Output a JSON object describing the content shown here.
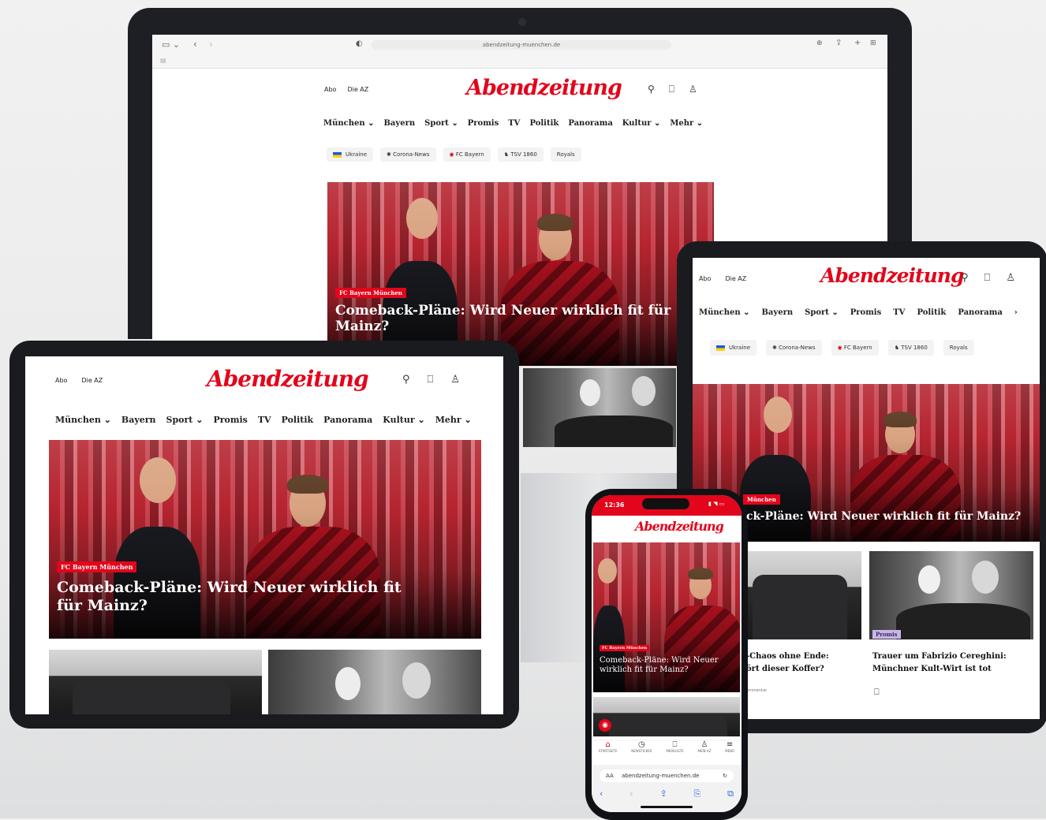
{
  "brand": {
    "logo": "Abendzeitung",
    "accent": "#e3051b"
  },
  "browser": {
    "url": "abendzeitung-muenchen.de"
  },
  "header": {
    "links": [
      "Abo",
      "Die AZ"
    ]
  },
  "nav": [
    "München ⌄",
    "Bayern",
    "Sport ⌄",
    "Promis",
    "TV",
    "Politik",
    "Panorama",
    "Kultur ⌄",
    "Mehr ⌄"
  ],
  "nav_tablet_right": [
    "München ⌄",
    "Bayern",
    "Sport ⌄",
    "Promis",
    "TV",
    "Politik",
    "Panorama",
    "›"
  ],
  "chips": [
    {
      "label": "Ukraine",
      "icon": "ukraine-flag-icon"
    },
    {
      "label": "Corona-News",
      "icon": "virus-icon"
    },
    {
      "label": "FC Bayern",
      "icon": "fc-bayern-icon"
    },
    {
      "label": "TSV 1860",
      "icon": "tsv-1860-icon"
    },
    {
      "label": "Royals",
      "icon": ""
    }
  ],
  "hero": {
    "badge": "FC Bayern München",
    "headline": "Comeback-Pläne: Wird Neuer wirklich fit für Mainz?",
    "headline_cropped": "ck-Pläne: Wird Neuer wirklich fit für Mainz?",
    "badge_cropped": "München"
  },
  "articles": [
    {
      "title_cropped": "-Chaos ohne Ende:",
      "title_cropped_2": "ört dieser Koffer?",
      "meta": "ommentar"
    },
    {
      "badge": "Promis",
      "title": "Trauer um Fabrizio Cereghini:",
      "title_2": "Münchner Kult-Wirt ist tot"
    }
  ],
  "phone": {
    "time": "12:36",
    "tabbar": [
      {
        "icon": "home-icon",
        "label": "STARTSEITE"
      },
      {
        "icon": "clock-icon",
        "label": "NEWSTICKER"
      },
      {
        "icon": "bookmark-icon",
        "label": "MERKLISTE"
      },
      {
        "icon": "user-icon",
        "label": "MEIN AZ"
      },
      {
        "icon": "menu-icon",
        "label": "MENÜ"
      }
    ],
    "url": "abendzeitung-muenchen.de",
    "url_prefix": "AA"
  }
}
